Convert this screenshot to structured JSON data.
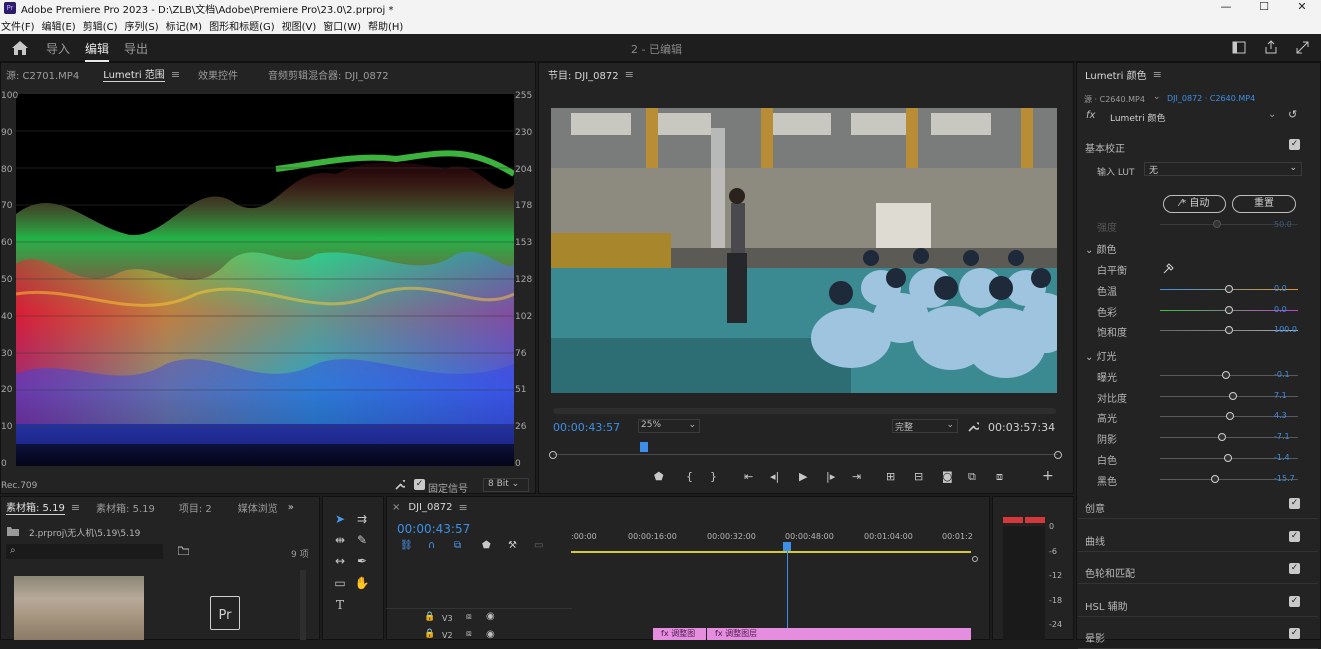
{
  "title_bar": {
    "app_icon": "Pr",
    "title": "Adobe Premiere Pro 2023 - D:\\ZLB\\文档\\Adobe\\Premiere Pro\\23.0\\2.prproj *",
    "minimize": "—",
    "maximize": "☐",
    "close": "✕"
  },
  "menu": [
    "文件(F)",
    "编辑(E)",
    "剪辑(C)",
    "序列(S)",
    "标记(M)",
    "图形和标题(G)",
    "视图(V)",
    "窗口(W)",
    "帮助(H)"
  ],
  "workspace": {
    "tabs": [
      "导入",
      "编辑",
      "导出"
    ],
    "active_tab": "编辑",
    "document_title": "2 - 已编辑"
  },
  "source_panel": {
    "tabs": [
      "源: C2701.MP4",
      "Lumetri 范围",
      "效果控件",
      "音频剪辑混合器: DJI_0872"
    ],
    "active_tab": "Lumetri 范围",
    "left_scale": [
      "100",
      "90",
      "80",
      "70",
      "60",
      "50",
      "40",
      "30",
      "20",
      "10",
      "0"
    ],
    "right_scale": [
      "255",
      "230",
      "204",
      "178",
      "153",
      "128",
      "102",
      "76",
      "51",
      "26",
      "0"
    ],
    "colorspace": "Rec.709",
    "clamp_label": "固定信号",
    "bit_depth": "8 Bit"
  },
  "program_panel": {
    "title": "节目: DJI_0872",
    "timecode": "00:00:43:57",
    "zoom": "25%",
    "quality": "完整",
    "duration": "00:03:57:34",
    "playhead_fraction": 0.18
  },
  "lumetri": {
    "title": "Lumetri 颜色",
    "source": "源 · C2640.MP4",
    "clip": "DJI_0872 · C2640.MP4",
    "fx_label": "fx",
    "effect": "Lumetri 颜色",
    "basic": "基本校正",
    "lut_label": "输入 LUT",
    "lut_value": "无",
    "auto": "自动",
    "reset": "重置",
    "intensity_label": "强度",
    "intensity_value": "50.0",
    "color_section": "颜色",
    "white_balance": "白平衡",
    "sliders_color": [
      {
        "label": "色温",
        "value": "0.0",
        "pos": 0.5
      },
      {
        "label": "色彩",
        "value": "0.0",
        "pos": 0.5
      },
      {
        "label": "饱和度",
        "value": "100.0",
        "pos": 0.5
      }
    ],
    "light_section": "灯光",
    "sliders_light": [
      {
        "label": "曝光",
        "value": "-0.1",
        "pos": 0.48
      },
      {
        "label": "对比度",
        "value": "7.1",
        "pos": 0.53
      },
      {
        "label": "高光",
        "value": "4.3",
        "pos": 0.51
      },
      {
        "label": "阴影",
        "value": "-7.1",
        "pos": 0.45
      },
      {
        "label": "白色",
        "value": "-1.4",
        "pos": 0.49
      },
      {
        "label": "黑色",
        "value": "-15.7",
        "pos": 0.4
      }
    ],
    "sections": [
      "创意",
      "曲线",
      "色轮和匹配",
      "HSL 辅助",
      "晕影"
    ],
    "colors": {
      "accent": "#3e8fe8",
      "temp_left": "#3b8fe6",
      "temp_right": "#e09a2c",
      "tint_left": "#39c33d",
      "tint_right": "#c63fd1"
    }
  },
  "project_panel": {
    "tabs": [
      "素材箱: 5.19",
      "素材箱: 5.19",
      "项目: 2",
      "媒体浏览"
    ],
    "path": "2.prproj\\无人机\\5.19\\5.19",
    "count": "9 项",
    "search_placeholder": ""
  },
  "timeline": {
    "sequence": "DJI_0872",
    "timecode": "00:00:43:57",
    "ruler": [
      ":00:00",
      "00:00:16:00",
      "00:00:32:00",
      "00:00:48:00",
      "00:01:04:00",
      "00:01:2"
    ],
    "tracks": [
      "V3",
      "V2"
    ],
    "clips": [
      "调整图",
      "调整图层"
    ],
    "playhead_fraction": 0.54
  },
  "audio_meter": {
    "scale": [
      "0",
      "-6",
      "-12",
      "-18",
      "-24"
    ]
  },
  "icons": [
    "home-icon",
    "panel-icon",
    "share-icon",
    "fullscreen-icon",
    "wrench-icon",
    "play-icon",
    "step-back-icon",
    "step-forward-icon",
    "marker-icon",
    "camera-icon",
    "add-icon",
    "selection-tool-icon",
    "hand-tool-icon",
    "text-tool-icon",
    "pen-tool-icon",
    "razor-tool-icon",
    "lock-icon",
    "eye-icon",
    "folder-icon",
    "search-icon",
    "eyedropper-icon",
    "undo-icon"
  ]
}
